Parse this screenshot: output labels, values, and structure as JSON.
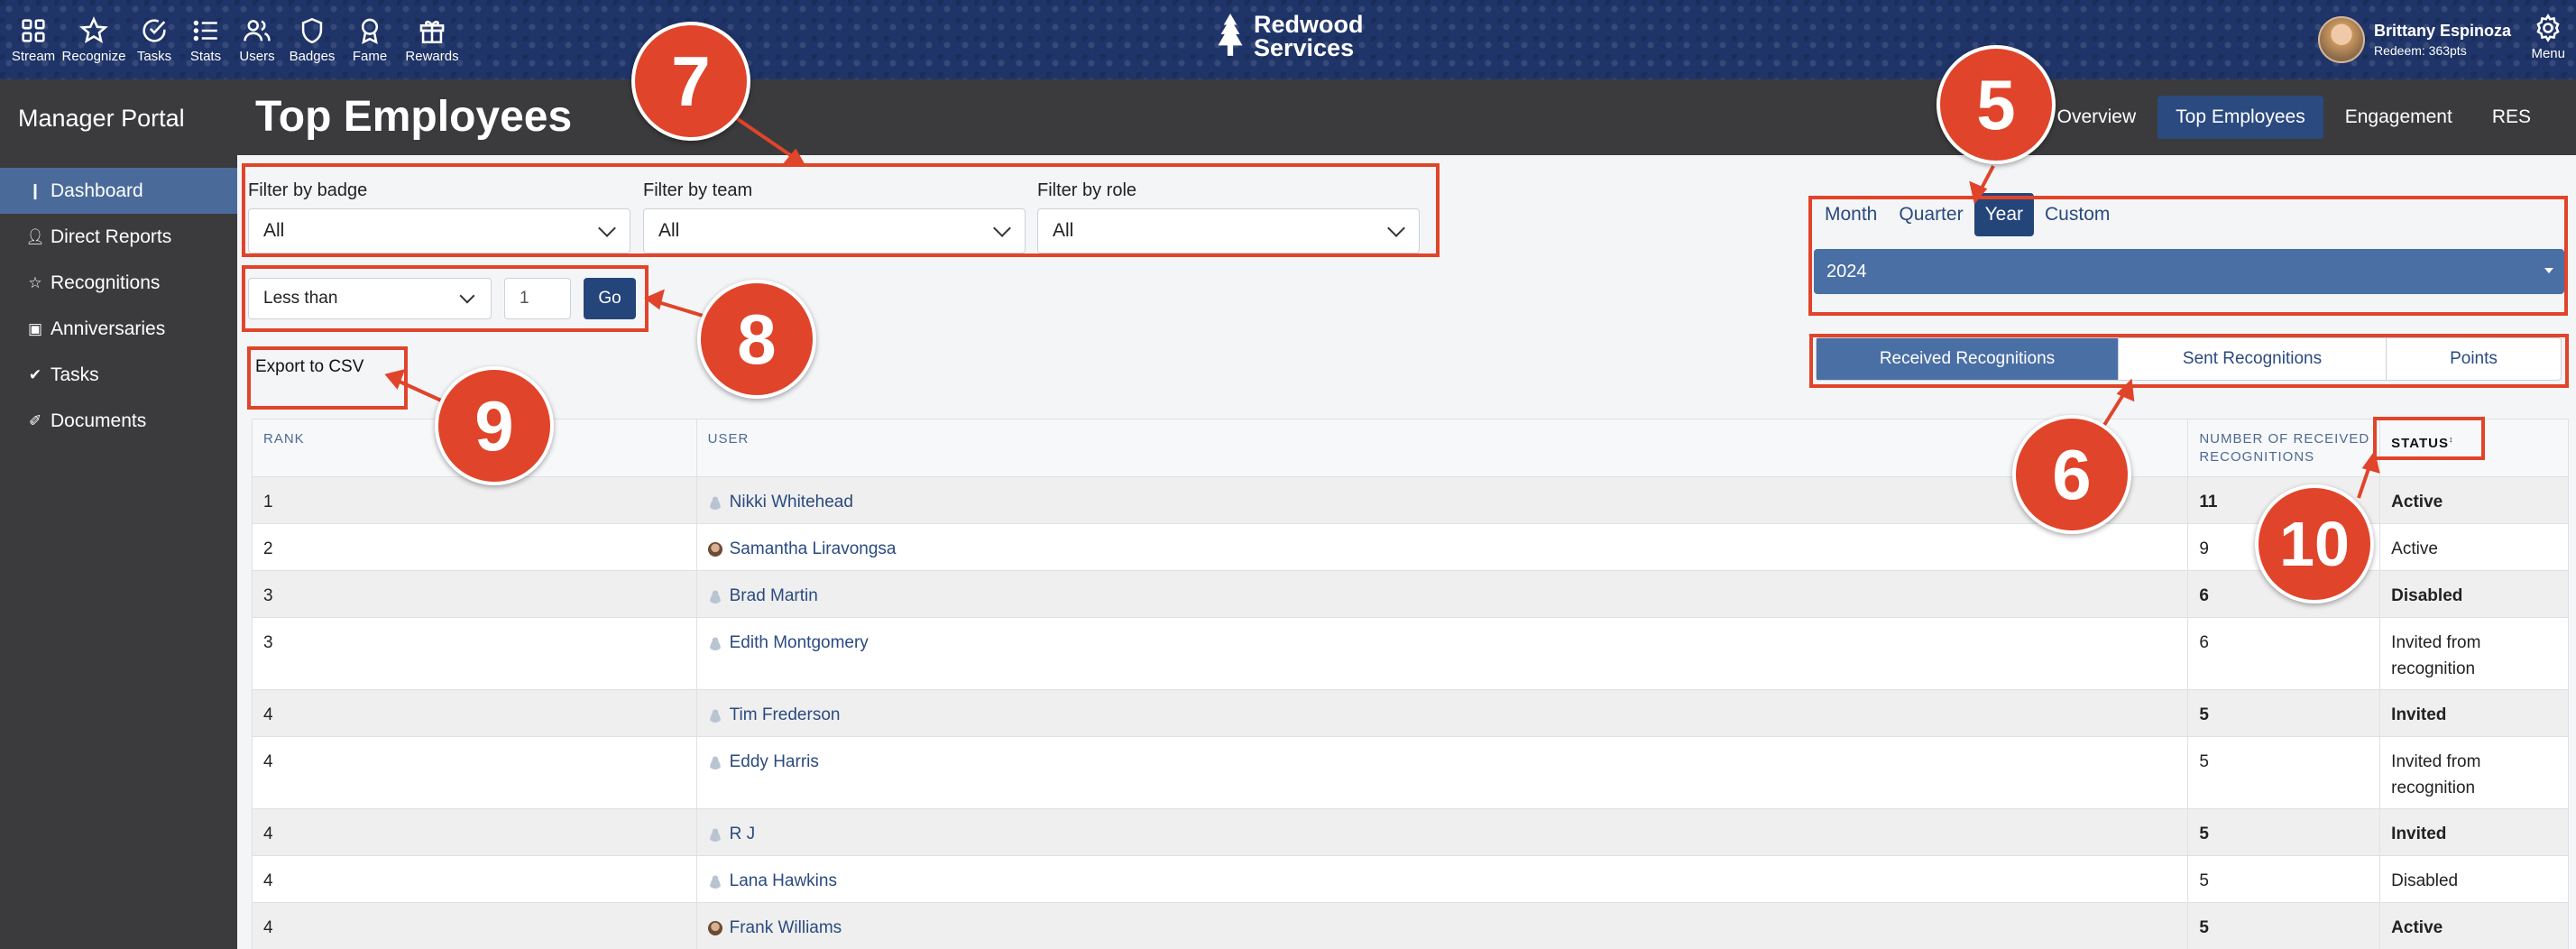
{
  "topnav": {
    "items": [
      {
        "label": "Stream",
        "icon": "grid-icon"
      },
      {
        "label": "Recognize",
        "icon": "star-icon"
      },
      {
        "label": "Tasks",
        "icon": "check-circle-icon"
      },
      {
        "label": "Stats",
        "icon": "list-icon"
      },
      {
        "label": "Users",
        "icon": "users-icon"
      },
      {
        "label": "Badges",
        "icon": "shield-icon"
      },
      {
        "label": "Fame",
        "icon": "award-icon"
      },
      {
        "label": "Rewards",
        "icon": "gift-icon"
      }
    ],
    "brand_line1": "Redwood",
    "brand_line2": "Services",
    "user_name": "Brittany Espinoza",
    "user_points": "Redeem: 363pts",
    "menu_label": "Menu"
  },
  "sidebar": {
    "title": "Manager Portal",
    "items": [
      {
        "label": "Dashboard",
        "icon": "bar-chart-icon",
        "active": true
      },
      {
        "label": "Direct Reports",
        "icon": "user-icon"
      },
      {
        "label": "Recognitions",
        "icon": "star-icon"
      },
      {
        "label": "Anniversaries",
        "icon": "calendar-icon"
      },
      {
        "label": "Tasks",
        "icon": "check-circle-icon"
      },
      {
        "label": "Documents",
        "icon": "paperclip-icon"
      }
    ]
  },
  "header": {
    "title": "Top Employees",
    "tabs": [
      "Overview",
      "Top Employees",
      "Engagement",
      "RES"
    ],
    "active_tab": "Top Employees"
  },
  "filters": {
    "badge_label": "Filter by badge",
    "badge_value": "All",
    "team_label": "Filter by team",
    "team_value": "All",
    "role_label": "Filter by role",
    "role_value": "All"
  },
  "compare": {
    "operator": "Less than",
    "value": "1",
    "go_label": "Go"
  },
  "export_label": "Export to CSV",
  "period": {
    "tabs": [
      "Month",
      "Quarter",
      "Year",
      "Custom"
    ],
    "active": "Year",
    "year_value": "2024"
  },
  "recognition_tabs": {
    "items": [
      "Received Recognitions",
      "Sent Recognitions",
      "Points"
    ],
    "active": "Received Recognitions"
  },
  "table": {
    "headers": {
      "rank": "RANK",
      "user": "USER",
      "number_line1": "NUMBER OF RECEIVED",
      "number_line2": "RECOGNITIONS",
      "status": "STATUS"
    },
    "rows": [
      {
        "rank": "1",
        "user": "Nikki Whitehead",
        "count": "11",
        "status": "Active",
        "avatar": "placeholder"
      },
      {
        "rank": "2",
        "user": "Samantha Liravongsa",
        "count": "9",
        "status": "Active",
        "avatar": "photo"
      },
      {
        "rank": "3",
        "user": "Brad Martin",
        "count": "6",
        "status": "Disabled",
        "avatar": "placeholder"
      },
      {
        "rank": "3",
        "user": "Edith Montgomery",
        "count": "6",
        "status": "Invited from recognition",
        "avatar": "placeholder"
      },
      {
        "rank": "4",
        "user": "Tim Frederson",
        "count": "5",
        "status": "Invited",
        "avatar": "placeholder"
      },
      {
        "rank": "4",
        "user": "Eddy Harris",
        "count": "5",
        "status": "Invited from recognition",
        "avatar": "placeholder"
      },
      {
        "rank": "4",
        "user": "R J",
        "count": "5",
        "status": "Invited",
        "avatar": "placeholder"
      },
      {
        "rank": "4",
        "user": "Lana Hawkins",
        "count": "5",
        "status": "Disabled",
        "avatar": "placeholder"
      },
      {
        "rank": "4",
        "user": "Frank Williams",
        "count": "5",
        "status": "Active",
        "avatar": "photo"
      }
    ]
  },
  "callouts": [
    "7",
    "5",
    "8",
    "9",
    "6",
    "10"
  ],
  "colors": {
    "nav": "#1f3468",
    "accent": "#24457a",
    "callout": "#e0442a",
    "sidebar": "#3b3b3d"
  }
}
